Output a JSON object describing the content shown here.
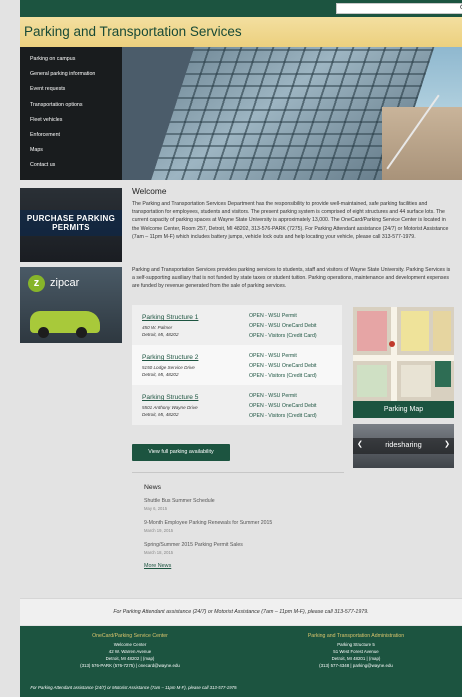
{
  "site": {
    "title": "Parking and Transportation Services"
  },
  "search": {
    "placeholder": ""
  },
  "nav": {
    "items": [
      "Parking on campus",
      "General parking information",
      "Event requests",
      "Transportation options",
      "Fleet vehicles",
      "Enforcement",
      "Maps",
      "Contact us"
    ]
  },
  "ads": {
    "permits_label": "PURCHASE PARKING PERMITS",
    "zipcar_label": "zipcar"
  },
  "welcome": {
    "heading": "Welcome",
    "p1": "The Parking and Transportation Services Department has the responsibility to provide well-maintained, safe parking facilities and transportation for employees, students and visitors. The present parking system is comprised of eight structures and 44 surface lots. The current capacity of parking spaces at Wayne State University is approximately 13,000. The OneCard/Parking Service Center is located in the Welcome Center, Room 257, Detroit, MI 48202, 313-576-PARK (7275). For Parking Attendant assistance (24/7) or Motorist Assistance (7am – 11pm M-F) which includes battery jumps, vehicle lock outs and help locating your vehicle, please call 313-577-1979.",
    "p2": "Parking and Transportation Services provides parking services to students, staff and visitors of Wayne State University. Parking Services is a self-supporting auxiliary that is not funded by state taxes or student tuition. Parking operations, maintenance and development expenses are funded by revenue generated from the sale of parking services."
  },
  "structures": [
    {
      "name": "Parking Structure 1",
      "addr1": "450 W. Palmer",
      "addr2": "Detroit, MI, 48202",
      "status": [
        "OPEN - WSU Permit",
        "OPEN - WSU OneCard Debit",
        "OPEN - Visitors (Credit Card)"
      ]
    },
    {
      "name": "Parking Structure 2",
      "addr1": "5150 Lodge Service Drive",
      "addr2": "Detroit, MI, 48202",
      "status": [
        "OPEN - WSU Permit",
        "OPEN - WSU OneCard Debit",
        "OPEN - Visitors (Credit Card)"
      ]
    },
    {
      "name": "Parking Structure 5",
      "addr1": "5501 Anthony Wayne Drive",
      "addr2": "Detroit, MI, 48202",
      "status": [
        "OPEN - WSU Permit",
        "OPEN - WSU OneCard Debit",
        "OPEN - Visitors (Credit Card)"
      ]
    }
  ],
  "buttons": {
    "availability": "View full parking availability"
  },
  "sidebar": {
    "map_label": "Parking Map",
    "rides_label": "ridesharing"
  },
  "news": {
    "heading": "News",
    "items": [
      {
        "title": "Shuttle Bus Summer Schedule",
        "date": "May 6, 2015"
      },
      {
        "title": "9-Month Employee Parking Renewals for Summer 2015",
        "date": "March 19, 2015"
      },
      {
        "title": "Spring/Summer 2015 Parking Permit Sales",
        "date": "March 18, 2015"
      }
    ],
    "more": "More News"
  },
  "notice": {
    "text": "For Parking Attendant assistance (24/7) or Motorist Assistance (7am – 11pm M-F), please call 313-577-1979."
  },
  "footer": {
    "left": {
      "heading": "OneCard/Parking Service Center",
      "lines": [
        "Welcome Center",
        "42 W. Warren Avenue",
        "Detroit, MI 48202 | (map)",
        "(313) 576-PARK (576-7275) | onecard@wayne.edu"
      ]
    },
    "right": {
      "heading": "Parking and Transportation Administration",
      "lines": [
        "Parking Structure 5",
        "51 West Forest Avenue",
        "Detroit, MI 48201 | (map)",
        "(313) 577-4348 | parking@wayne.edu"
      ]
    },
    "bottom": "For Parking Attendant assistance (24/7) or Motorist Assistance (7am – 11pm M-F), please call 313-577-1979."
  },
  "colors": {
    "brand_green": "#1c5440",
    "brand_gold": "#ecd07e",
    "footer_heading": "#d8c46c"
  }
}
